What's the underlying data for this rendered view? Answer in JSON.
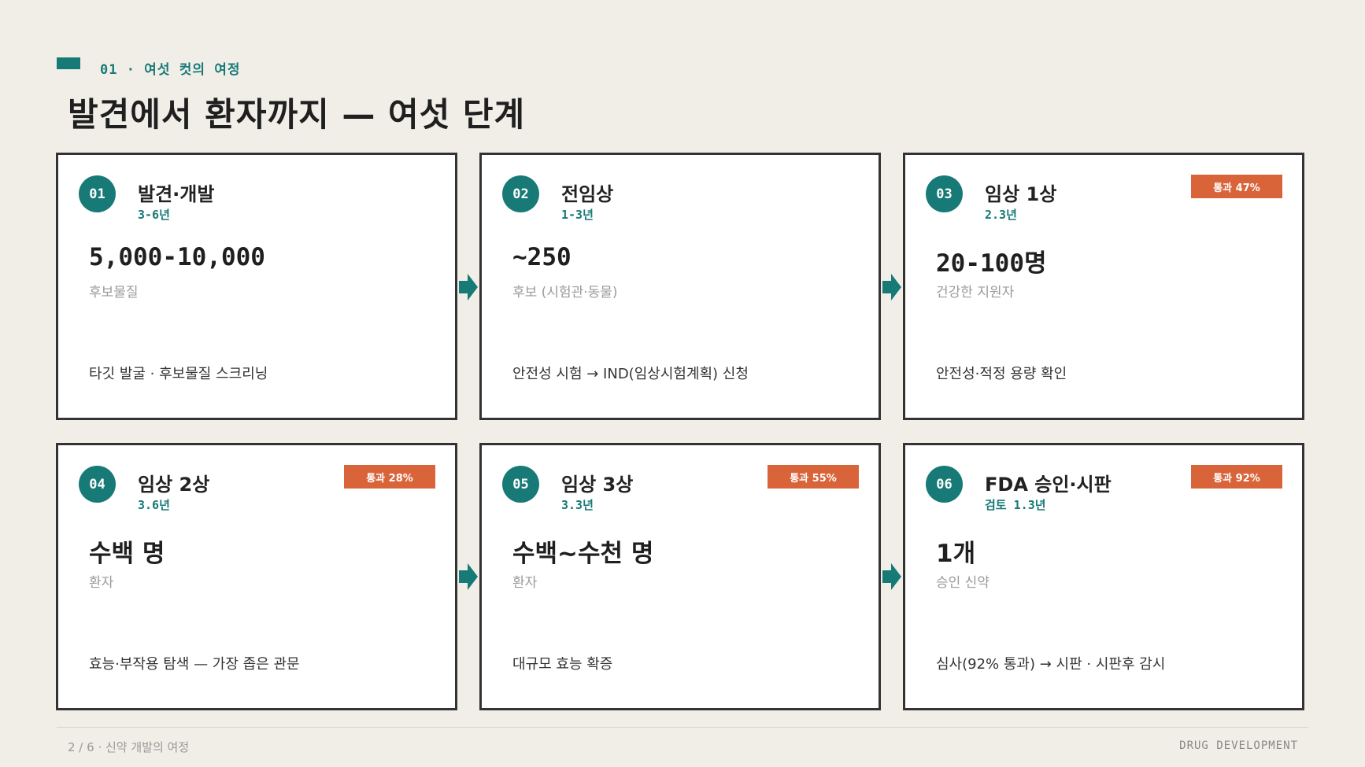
{
  "header": {
    "kicker": "01 · 여섯 컷의 여정",
    "title": "발견에서 환자까지 — 여섯 단계"
  },
  "stages": [
    {
      "num": "01",
      "name": "발견·개발",
      "duration": "3-6년",
      "figure": "5,000-10,000",
      "figure_label": "후보물질",
      "description": "타깃 발굴 · 후보물질 스크리닝"
    },
    {
      "num": "02",
      "name": "전임상",
      "duration": "1-3년",
      "figure": "~250",
      "figure_label": "후보 (시험관·동물)",
      "description": "안전성 시험 → IND(임상시험계획) 신청"
    },
    {
      "num": "03",
      "name": "임상 1상",
      "duration": "2.3년",
      "badge": "통과 47%",
      "figure": "20-100명",
      "figure_label": "건강한 지원자",
      "description": "안전성·적정 용량 확인"
    },
    {
      "num": "04",
      "name": "임상 2상",
      "duration": "3.6년",
      "badge": "통과 28%",
      "figure": "수백 명",
      "figure_label": "환자",
      "description": "효능·부작용 탐색 — 가장 좁은 관문"
    },
    {
      "num": "05",
      "name": "임상 3상",
      "duration": "3.3년",
      "badge": "통과 55%",
      "figure": "수백~수천 명",
      "figure_label": "환자",
      "description": "대규모 효능 확증"
    },
    {
      "num": "06",
      "name": "FDA 승인·시판",
      "duration": "검토 1.3년",
      "badge": "통과 92%",
      "figure": "1개",
      "figure_label": "승인 신약",
      "description": "심사(92% 통과) → 시판 · 시판후 감시"
    }
  ],
  "footer": {
    "left": "2 / 6 · 신약 개발의 여정",
    "right": "DRUG DEVELOPMENT"
  },
  "colors": {
    "accent": "#177a76",
    "badge": "#d9643a",
    "background": "#f1eee8"
  }
}
